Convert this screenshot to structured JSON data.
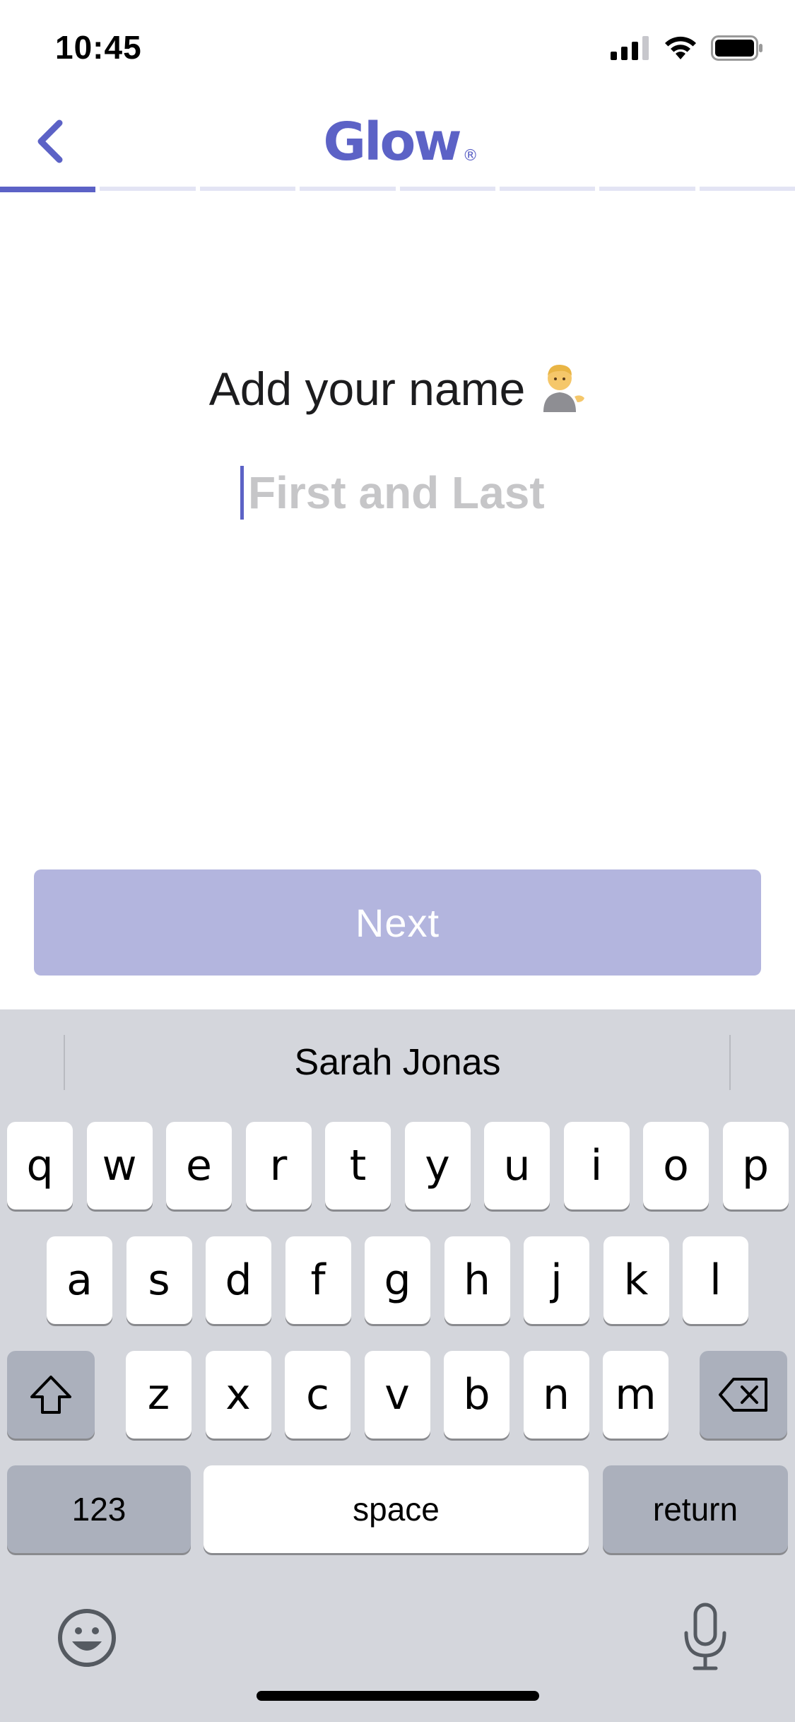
{
  "status_bar": {
    "time": "10:45"
  },
  "header": {
    "back_icon": "chevron-left-icon",
    "logo_text": "Glow",
    "logo_mark": "®",
    "accent_color": "#5c62c6"
  },
  "progress": {
    "total_steps": 8,
    "current_step": 1
  },
  "form": {
    "prompt": "Add your name",
    "prompt_emoji": "person-tipping-hand",
    "input_value": "",
    "input_placeholder": "First and Last"
  },
  "next_button": {
    "label": "Next",
    "state": "disabled"
  },
  "keyboard": {
    "suggestion": "Sarah Jonas",
    "row1": [
      "q",
      "w",
      "e",
      "r",
      "t",
      "y",
      "u",
      "i",
      "o",
      "p"
    ],
    "row2": [
      "a",
      "s",
      "d",
      "f",
      "g",
      "h",
      "j",
      "k",
      "l"
    ],
    "row3": [
      "z",
      "x",
      "c",
      "v",
      "b",
      "n",
      "m"
    ],
    "shift_icon": "shift-icon",
    "delete_icon": "backspace-icon",
    "numbers_label": "123",
    "space_label": "space",
    "return_label": "return",
    "emoji_icon": "emoji-icon",
    "mic_icon": "microphone-icon"
  }
}
